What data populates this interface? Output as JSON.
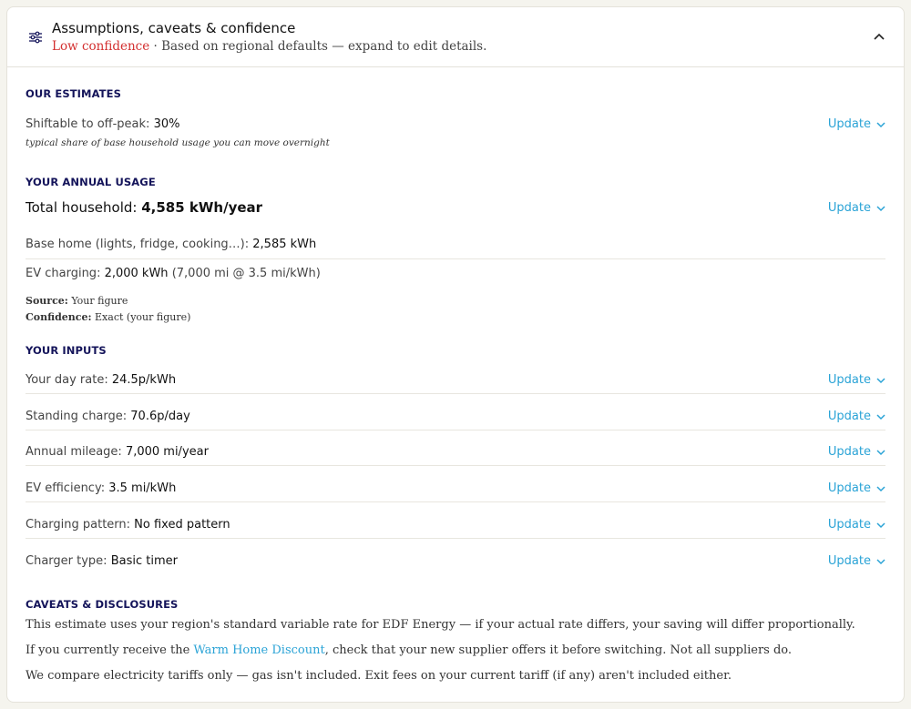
{
  "header": {
    "title": "Assumptions, caveats & confidence",
    "confidence": "Low confidence",
    "subtitle": " · Based on regional defaults — expand to edit details."
  },
  "update_label": "Update",
  "estimates": {
    "title": "OUR ESTIMATES",
    "shiftable_label": "Shiftable to off-peak: ",
    "shiftable_value": "30%",
    "shiftable_note": "typical share of base household usage you can move overnight"
  },
  "usage": {
    "title": "YOUR ANNUAL USAGE",
    "total_label": "Total household: ",
    "total_value": "4,585 kWh/year",
    "base_label": "Base home (lights, fridge, cooking…): ",
    "base_value": "2,585 kWh",
    "ev_label": "EV charging: ",
    "ev_value": "2,000 kWh",
    "ev_detail": " (7,000 mi @ 3.5 mi/kWh)",
    "source_label": "Source:",
    "source_value": " Your figure",
    "confidence_label": "Confidence:",
    "confidence_value": " Exact (your figure)"
  },
  "inputs": {
    "title": "YOUR INPUTS",
    "rows": [
      {
        "label": "Your day rate: ",
        "value": "24.5p/kWh"
      },
      {
        "label": "Standing charge: ",
        "value": "70.6p/day"
      },
      {
        "label": "Annual mileage: ",
        "value": "7,000 mi/year"
      },
      {
        "label": "EV efficiency: ",
        "value": "3.5 mi/kWh"
      },
      {
        "label": "Charging pattern: ",
        "value": "No fixed pattern"
      },
      {
        "label": "Charger type: ",
        "value": "Basic timer"
      }
    ]
  },
  "caveats": {
    "title": "CAVEATS & DISCLOSURES",
    "line1": "This estimate uses your region's standard variable rate for EDF Energy — if your actual rate differs, your saving will differ proportionally.",
    "line2_pre": "If you currently receive the ",
    "line2_link": "Warm Home Discount",
    "line2_post": ", check that your new supplier offers it before switching. Not all suppliers do.",
    "line3": "We compare electricity tariffs only — gas isn't included. Exit fees on your current tariff (if any) aren't included either."
  },
  "colors": {
    "accent": "#2aa3d6",
    "heading": "#14145a",
    "low": "#d32f2f"
  }
}
